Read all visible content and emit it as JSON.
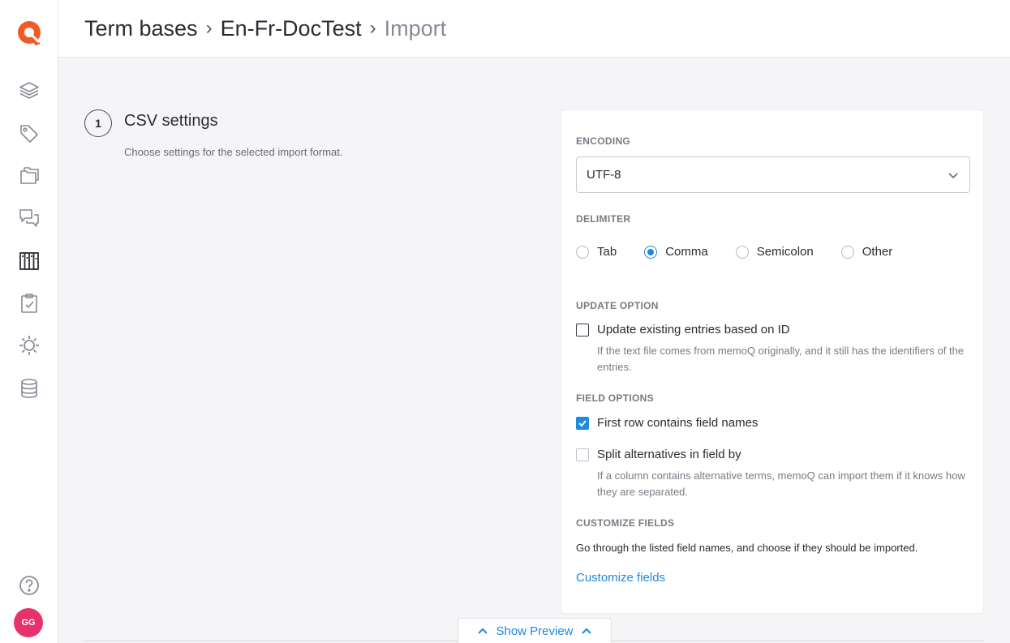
{
  "header": {
    "breadcrumb": [
      "Term bases",
      "En-Fr-DocTest"
    ],
    "current": "Import",
    "separator": "›"
  },
  "user": {
    "initials": "GG"
  },
  "sidebar": {
    "icons": [
      "layers-icon",
      "tag-icon",
      "folders-icon",
      "chat-icon",
      "library-icon",
      "clipboard-check-icon",
      "gear-icon",
      "database-icon",
      "help-icon"
    ]
  },
  "step": {
    "number": "1",
    "title": "CSV settings",
    "description": "Choose settings for the selected import format."
  },
  "encoding": {
    "label": "ENCODING",
    "value": "UTF-8"
  },
  "delimiter": {
    "label": "DELIMITER",
    "options": [
      "Tab",
      "Comma",
      "Semicolon",
      "Other"
    ],
    "selected": "Comma"
  },
  "update_option": {
    "label": "UPDATE OPTION",
    "checkbox_label": "Update existing entries based on ID",
    "checked": false,
    "help": "If the text file comes from memoQ originally, and it still has the identifiers of the entries."
  },
  "field_options": {
    "label": "FIELD OPTIONS",
    "first_row_label": "First row contains field names",
    "first_row_checked": true,
    "split_label": "Split alternatives in field by",
    "split_checked": false,
    "split_help": "If a column contains alternative terms, memoQ can import them if it knows how they are separated."
  },
  "customize": {
    "label": "CUSTOMIZE FIELDS",
    "description": "Go through the listed field names, and choose if they should be imported.",
    "link": "Customize fields"
  },
  "preview": {
    "label": "Show Preview"
  },
  "colors": {
    "accent": "#1e88e5",
    "logo": "#f15a24",
    "avatar": "#e8326b"
  }
}
